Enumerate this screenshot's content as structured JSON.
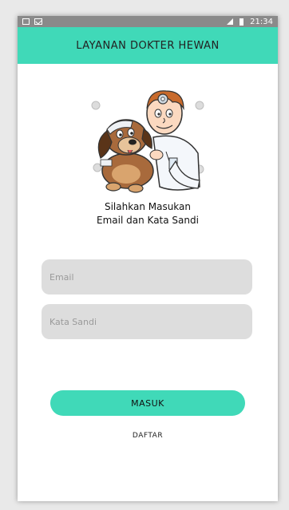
{
  "statusbar": {
    "time": "21:34"
  },
  "appbar": {
    "title": "LAYANAN DOKTER HEWAN"
  },
  "prompt": {
    "line1": "Silahkan Masukan",
    "line2": "Email dan Kata Sandi"
  },
  "form": {
    "email_placeholder": "Email",
    "password_placeholder": "Kata Sandi",
    "login_label": "MASUK",
    "register_label": "DAFTAR"
  },
  "colors": {
    "accent": "#40d9b8",
    "field_bg": "#dddddd",
    "statusbar": "#8a8a8a"
  },
  "icons": [
    "notification-icon",
    "mail-icon",
    "signal-icon",
    "battery-icon",
    "vet-illustration"
  ]
}
